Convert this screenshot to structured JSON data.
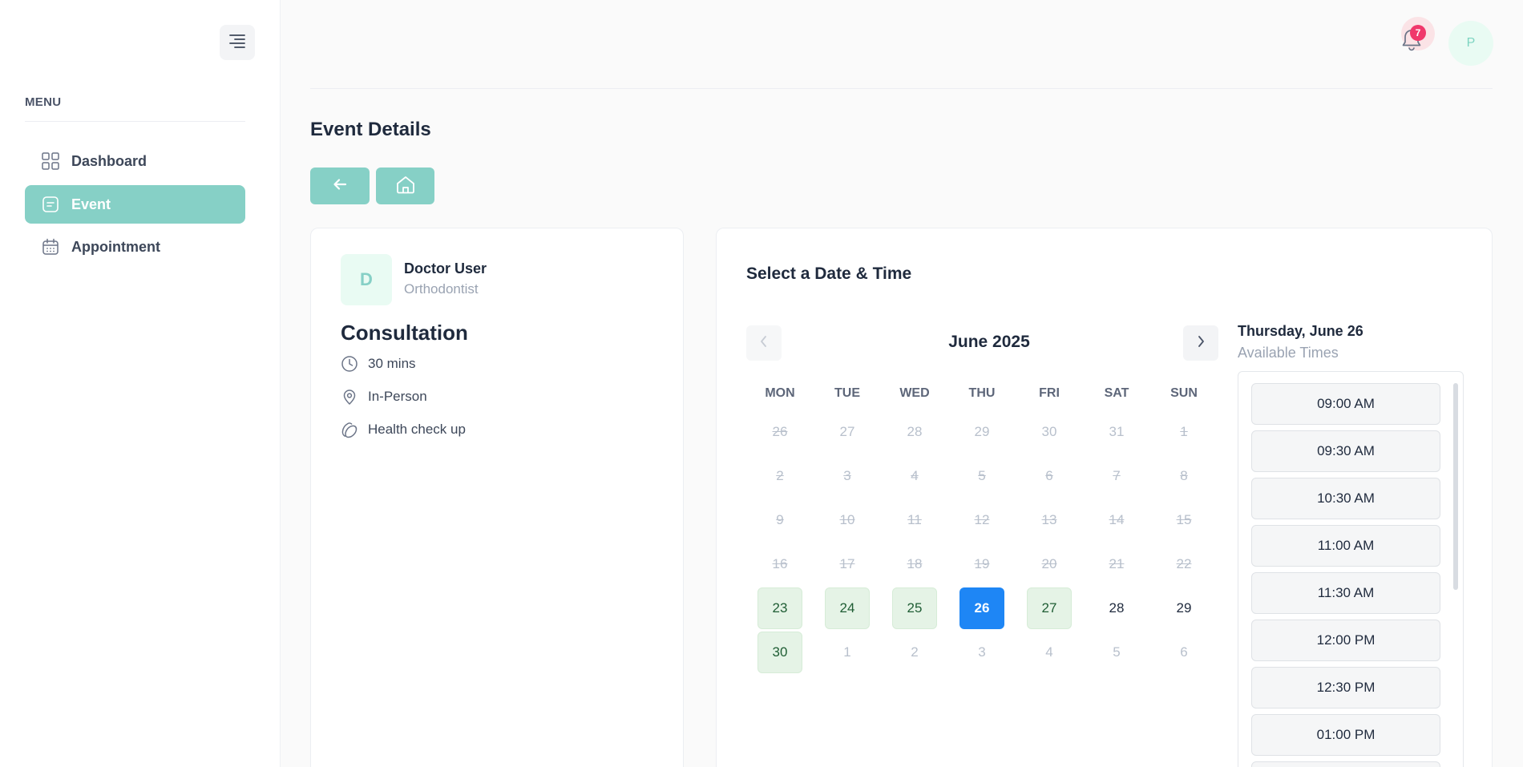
{
  "sidebar": {
    "menu_label": "MENU",
    "items": [
      {
        "label": "Dashboard",
        "icon": "grid-icon",
        "active": false
      },
      {
        "label": "Event",
        "icon": "event-icon",
        "active": true
      },
      {
        "label": "Appointment",
        "icon": "calendar-icon",
        "active": false
      }
    ]
  },
  "header": {
    "notification_count": "7",
    "avatar_initial": "P"
  },
  "page": {
    "title": "Event Details"
  },
  "event": {
    "doctor_initial": "D",
    "doctor_name": "Doctor User",
    "doctor_role": "Orthodontist",
    "name": "Consultation",
    "duration": "30 mins",
    "location": "In-Person",
    "description": "Health check up"
  },
  "booking": {
    "title": "Select a Date & Time",
    "month": "June 2025",
    "weekdays": [
      "MON",
      "TUE",
      "WED",
      "THU",
      "FRI",
      "SAT",
      "SUN"
    ],
    "weeks": [
      [
        {
          "d": "26",
          "s": "struck"
        },
        {
          "d": "27",
          "s": "muted"
        },
        {
          "d": "28",
          "s": "muted"
        },
        {
          "d": "29",
          "s": "muted"
        },
        {
          "d": "30",
          "s": "muted"
        },
        {
          "d": "31",
          "s": "muted"
        },
        {
          "d": "1",
          "s": "struck"
        }
      ],
      [
        {
          "d": "2",
          "s": "struck"
        },
        {
          "d": "3",
          "s": "struck"
        },
        {
          "d": "4",
          "s": "struck"
        },
        {
          "d": "5",
          "s": "struck"
        },
        {
          "d": "6",
          "s": "struck"
        },
        {
          "d": "7",
          "s": "struck"
        },
        {
          "d": "8",
          "s": "struck"
        }
      ],
      [
        {
          "d": "9",
          "s": "struck"
        },
        {
          "d": "10",
          "s": "struck"
        },
        {
          "d": "11",
          "s": "struck"
        },
        {
          "d": "12",
          "s": "struck"
        },
        {
          "d": "13",
          "s": "struck"
        },
        {
          "d": "14",
          "s": "struck"
        },
        {
          "d": "15",
          "s": "struck"
        }
      ],
      [
        {
          "d": "16",
          "s": "struck"
        },
        {
          "d": "17",
          "s": "struck"
        },
        {
          "d": "18",
          "s": "struck"
        },
        {
          "d": "19",
          "s": "struck"
        },
        {
          "d": "20",
          "s": "struck"
        },
        {
          "d": "21",
          "s": "struck"
        },
        {
          "d": "22",
          "s": "struck"
        }
      ],
      [
        {
          "d": "23",
          "s": "available"
        },
        {
          "d": "24",
          "s": "available"
        },
        {
          "d": "25",
          "s": "available"
        },
        {
          "d": "26",
          "s": "selected"
        },
        {
          "d": "27",
          "s": "available"
        },
        {
          "d": "28",
          "s": "open"
        },
        {
          "d": "29",
          "s": "open"
        }
      ],
      [
        {
          "d": "30",
          "s": "available"
        },
        {
          "d": "1",
          "s": "next-month"
        },
        {
          "d": "2",
          "s": "next-month"
        },
        {
          "d": "3",
          "s": "next-month"
        },
        {
          "d": "4",
          "s": "next-month"
        },
        {
          "d": "5",
          "s": "next-month"
        },
        {
          "d": "6",
          "s": "next-month"
        }
      ]
    ],
    "selected_date_label": "Thursday, June 26",
    "available_times_label": "Available Times",
    "times": [
      "09:00 AM",
      "09:30 AM",
      "10:30 AM",
      "11:00 AM",
      "11:30 AM",
      "12:00 PM",
      "12:30 PM",
      "01:00 PM",
      ""
    ]
  },
  "colors": {
    "accent": "#86d0c6",
    "selected_day": "#1e86f5",
    "available_day": "#e5f3e6",
    "badge": "#f0386b"
  }
}
